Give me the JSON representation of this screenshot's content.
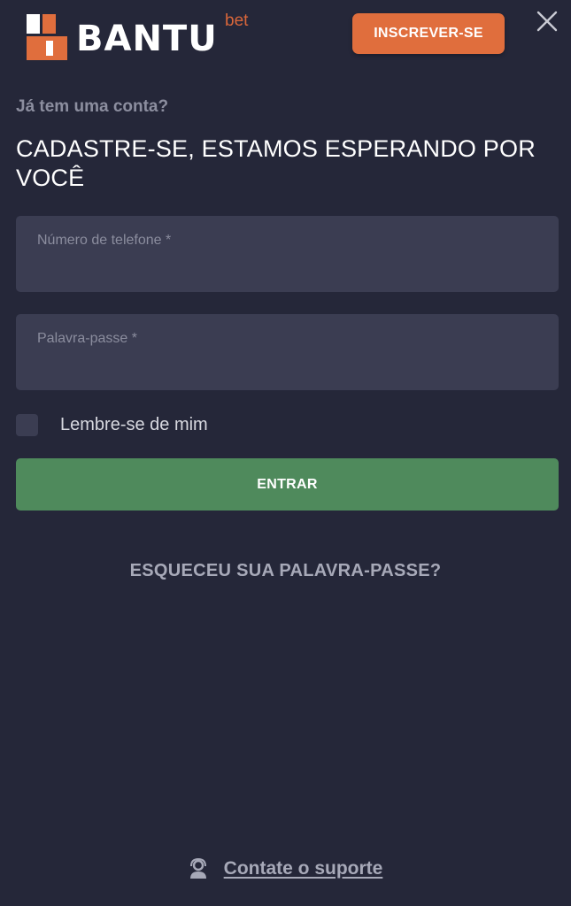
{
  "header": {
    "logo_word": "BANTU",
    "logo_suffix": "bet",
    "signup_label": "INSCREVER-SE"
  },
  "form": {
    "subtitle": "Já tem uma conta?",
    "headline": "CADASTRE-SE, ESTAMOS ESPERANDO POR VOCÊ",
    "phone_label": "Número de telefone *",
    "phone_value": "",
    "password_label": "Palavra-passe *",
    "password_value": "",
    "remember_label": "Lembre-se de mim",
    "remember_checked": false,
    "submit_label": "ENTRAR",
    "forgot_label": "ESQUECEU SUA PALAVRA-PASSE?"
  },
  "footer": {
    "support_label": "Contate o suporte"
  },
  "icons": {
    "close": "close-icon",
    "support": "support-agent-icon",
    "logo": "bantu-logo-icon"
  },
  "colors": {
    "background": "#252739",
    "field": "#3b3d52",
    "accent_orange": "#e06e3d",
    "submit_green": "#4f8a5c",
    "muted_text": "#a7a9b8"
  }
}
